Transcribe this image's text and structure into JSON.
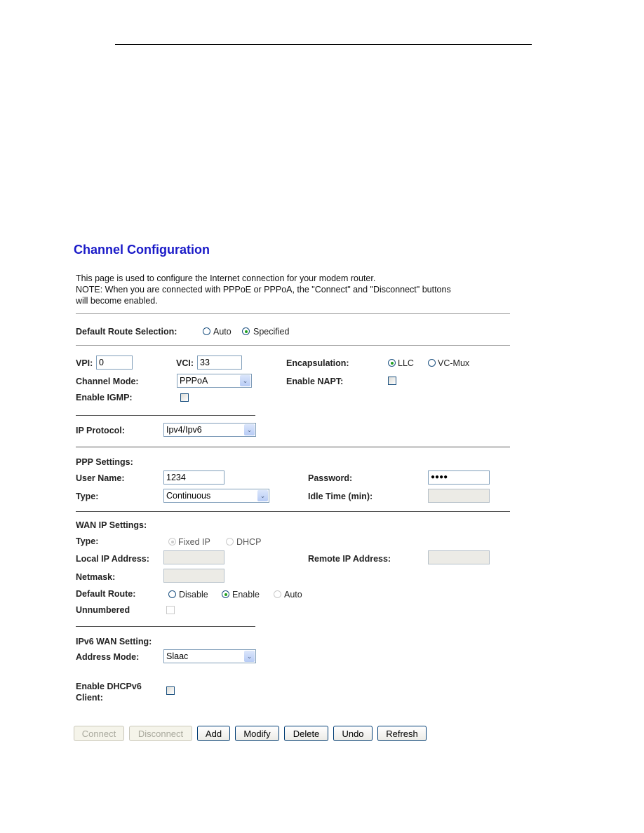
{
  "page": {
    "title": "Channel Configuration",
    "description": [
      "This page is used to configure the Internet connection for your modem router.",
      "NOTE: When you are connected with PPPoE or PPPoA, the \"Connect\" and \"Disconnect\" buttons",
      "will become enabled."
    ]
  },
  "default_route_selection": {
    "label": "Default Route Selection:",
    "options": [
      {
        "label": "Auto",
        "selected": false
      },
      {
        "label": "Specified",
        "selected": true
      }
    ]
  },
  "channel": {
    "vpi_label": "VPI:",
    "vpi_value": "0",
    "vci_label": "VCI:",
    "vci_value": "33",
    "encapsulation_label": "Encapsulation:",
    "encapsulation_options": [
      {
        "label": "LLC",
        "selected": true
      },
      {
        "label": "VC-Mux",
        "selected": false
      }
    ],
    "channel_mode_label": "Channel Mode:",
    "channel_mode_value": "PPPoA",
    "enable_napt_label": "Enable NAPT:",
    "enable_napt_checked": false,
    "enable_igmp_label": "Enable IGMP:",
    "enable_igmp_checked": false
  },
  "ip_protocol": {
    "label": "IP Protocol:",
    "value": "Ipv4/Ipv6"
  },
  "ppp": {
    "heading": "PPP Settings:",
    "username_label": "User Name:",
    "username_value": "1234",
    "password_label": "Password:",
    "password_value": "●●●●",
    "type_label": "Type:",
    "type_value": "Continuous",
    "idle_time_label": "Idle Time (min):",
    "idle_time_value": ""
  },
  "wan_ip": {
    "heading": "WAN IP Settings:",
    "type_label": "Type:",
    "type_options": [
      {
        "label": "Fixed IP",
        "selected": true,
        "disabled": true
      },
      {
        "label": "DHCP",
        "selected": false,
        "disabled": true
      }
    ],
    "local_ip_label": "Local IP Address:",
    "local_ip_value": "",
    "remote_ip_label": "Remote IP Address:",
    "remote_ip_value": "",
    "netmask_label": "Netmask:",
    "netmask_value": "",
    "default_route_label": "Default Route:",
    "default_route_options": [
      {
        "label": "Disable",
        "selected": false,
        "disabled": false
      },
      {
        "label": "Enable",
        "selected": true,
        "disabled": false
      },
      {
        "label": "Auto",
        "selected": false,
        "disabled": true
      }
    ],
    "unnumbered_label": "Unnumbered",
    "unnumbered_checked": false
  },
  "ipv6_wan": {
    "heading": "IPv6 WAN Setting:",
    "address_mode_label": "Address Mode:",
    "address_mode_value": "Slaac",
    "dhcpv6_label_line1": "Enable DHCPv6",
    "dhcpv6_label_line2": "Client:",
    "dhcpv6_checked": false
  },
  "buttons": {
    "connect": "Connect",
    "disconnect": "Disconnect",
    "add": "Add",
    "modify": "Modify",
    "delete": "Delete",
    "undo": "Undo",
    "refresh": "Refresh"
  },
  "icons": {
    "select_arrow": "⌄"
  }
}
